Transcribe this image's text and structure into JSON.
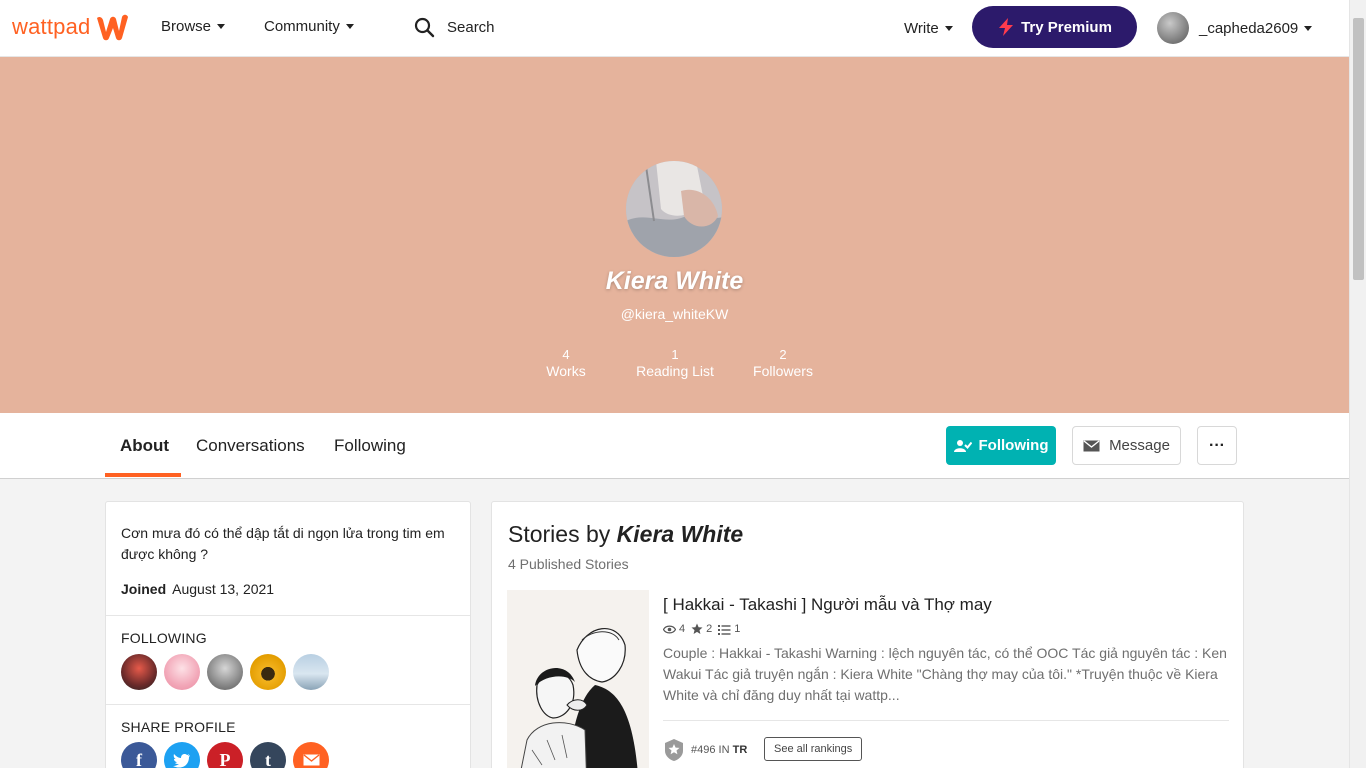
{
  "brand": {
    "logo_text": "wattpad",
    "accent": "#ff6122"
  },
  "nav": {
    "browse": "Browse",
    "community": "Community",
    "search": "Search",
    "write": "Write",
    "premium": "Try Premium",
    "username": "_capheda2609"
  },
  "profile": {
    "name": "Kiera White",
    "handle": "@kiera_whiteKW",
    "banner_color": "#e5b39c",
    "stats": [
      {
        "value": "4",
        "label": "Works"
      },
      {
        "value": "1",
        "label": "Reading List"
      },
      {
        "value": "2",
        "label": "Followers"
      }
    ]
  },
  "tabs": {
    "about": "About",
    "conversations": "Conversations",
    "following": "Following",
    "active": "About"
  },
  "actions": {
    "following": "Following",
    "message": "Message",
    "more": "···"
  },
  "about": {
    "description": "Cơn mưa đó có thể dập tắt di ngọn lửa trong tim em được không ?",
    "joined_label": "Joined",
    "joined_date": "August 13, 2021",
    "following_label": "FOLLOWING",
    "share_label": "SHARE PROFILE",
    "share_icons": [
      "facebook-icon",
      "twitter-icon",
      "pinterest-icon",
      "tumblr-icon",
      "email-icon"
    ]
  },
  "stories": {
    "title_prefix": "Stories by",
    "author": "Kiera White",
    "count_text": "4 Published Stories",
    "items": [
      {
        "title": "[ Hakkai - Takashi ] Người mẫu và Thợ may",
        "reads": "4",
        "votes": "2",
        "parts": "1",
        "description": "Couple : Hakkai - Takashi Warning : lệch nguyên tác, có thể OOC Tác giả nguyên tác : Ken Wakui Tác giả truyện ngắn : Kiera White \"Chàng thợ may của tôi.\" *Truyện thuộc về Kiera White và chỉ đăng duy nhất tại wattp...",
        "rank": "#496",
        "rank_in": "IN",
        "rank_tag": "TR",
        "see_rankings": "See all rankings"
      }
    ]
  }
}
